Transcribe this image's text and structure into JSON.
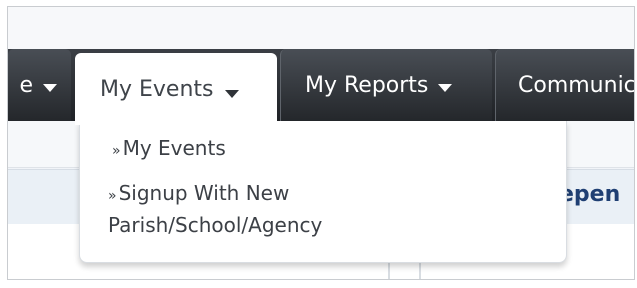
{
  "nav": {
    "left_tab_label": "e",
    "my_events_label": "My Events",
    "my_reports_label": "My Reports",
    "communication_label": "Communic"
  },
  "dropdown": {
    "items": [
      {
        "prefix": "»",
        "label": "My Events"
      },
      {
        "prefix": "»",
        "label": "Signup With New Parish/School/Agency"
      }
    ]
  },
  "content": {
    "peek_text": "epen"
  },
  "colors": {
    "nav_dark": "#23262a",
    "nav_text": "#ffffff",
    "active_tab": "#ffffff",
    "menu_text": "#3c4046",
    "link_blue": "#1f3f73"
  },
  "icons": {
    "tab_dropdown": "chevron-down-icon"
  }
}
